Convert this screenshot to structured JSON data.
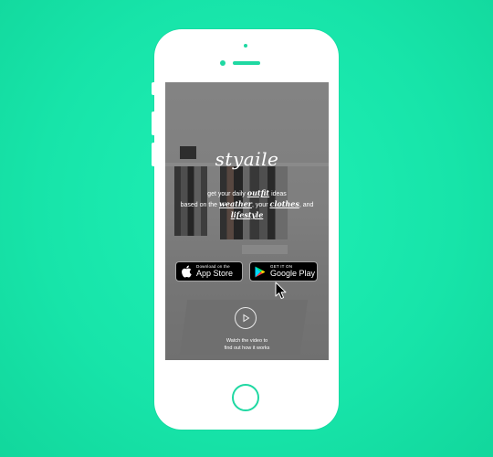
{
  "colors": {
    "background": "#17e4a9",
    "phone_accent": "#1fd8a2",
    "phone_body": "#ffffff"
  },
  "app": {
    "logo": "styaile",
    "tagline": {
      "p1": "get your daily ",
      "w_outfit": "outfit",
      "p2": " ideas",
      "p3": "based on the ",
      "w_weather": "weather",
      "p4": ", your ",
      "w_clothes": "clothes",
      "p5": ", and",
      "w_lifestyle": "lifestyle"
    },
    "app_store": {
      "small": "Download on the",
      "big": "App Store",
      "icon": "apple-icon"
    },
    "google_play": {
      "small": "GET IT ON",
      "big": "Google Play",
      "icon": "google-play-icon"
    },
    "video": {
      "icon": "play-icon",
      "line1": "Watch the video to",
      "line2": "find out how it works"
    }
  }
}
